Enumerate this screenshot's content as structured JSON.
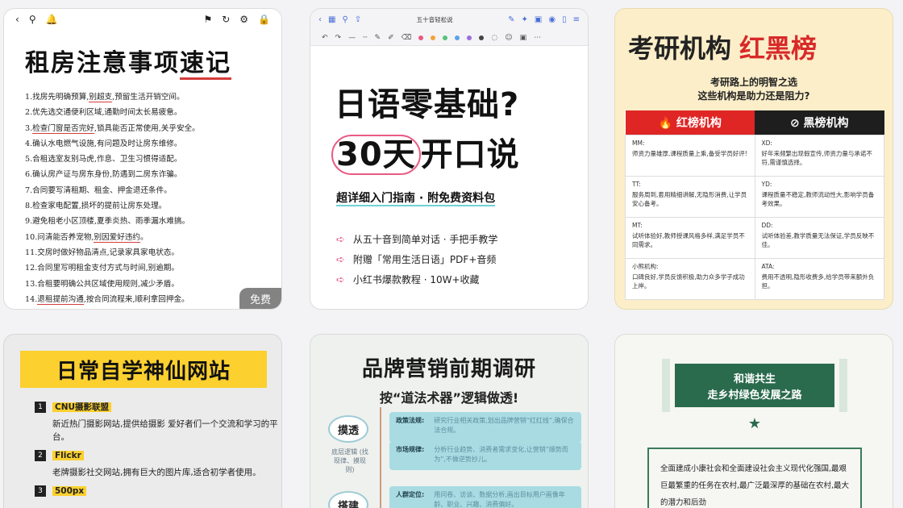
{
  "card1": {
    "title_main": "租房注意事项",
    "title_mark": "速记",
    "free_badge": "免费",
    "items": [
      {
        "pre": "1.找房先明确预算,",
        "mark": "别超支",
        "post": ",预留生活开销空间。"
      },
      {
        "pre": "2.优先选交通便利区域,通勤时间太长易疲惫。",
        "mark": "",
        "post": ""
      },
      {
        "pre": "3.",
        "mark": "检查门窗是否完好",
        "post": ",锁具能否正常使用,关乎安全。"
      },
      {
        "pre": "4.确认水电燃气设施,有问题及时让房东维修。",
        "mark": "",
        "post": ""
      },
      {
        "pre": "5.合租选室友别马虎,作息、卫生习惯得适配。",
        "mark": "",
        "post": ""
      },
      {
        "pre": "6.确认房产证与房东身份,防遇到二房东诈骗。",
        "mark": "",
        "post": ""
      },
      {
        "pre": "7.合同要写清租期、租金、押金退还条件。",
        "mark": "",
        "post": ""
      },
      {
        "pre": "8.检查家电配置,损坏的提前让房东处理。",
        "mark": "",
        "post": ""
      },
      {
        "pre": "9.避免租老小区顶楼,夏季炎热、雨季漏水难搞。",
        "mark": "",
        "post": ""
      },
      {
        "pre": "10.问清能否养宠物,",
        "mark": "别因爱好违约",
        "post": "。"
      },
      {
        "pre": "11.交房时做好物品清点,记录家具家电状态。",
        "mark": "",
        "post": ""
      },
      {
        "pre": "12.合同里写明租金支付方式与时间,别逾期。",
        "mark": "",
        "post": ""
      },
      {
        "pre": "13.合租要明确公共区域使用规则,减少矛盾。",
        "mark": "",
        "post": ""
      },
      {
        "pre": "14.",
        "mark": "退租提前沟通",
        "post": ",按合同流程来,顺利拿回押金。"
      }
    ]
  },
  "card2": {
    "doc_title": "五十音轻松说",
    "headline1": "日语零基础?",
    "headline2_circled": "30天",
    "headline2_rest": "开口说",
    "subtitle": "超详细入门指南 · 附免费资料包",
    "bullets": [
      "从五十音到简单对话 · 手把手教学",
      "附赠「常用生活日语」PDF+音频",
      "小红书爆款教程 · 10W+收藏"
    ],
    "colors": [
      "#e85a83",
      "#f3a33b",
      "#58c27a",
      "#5aa3e8",
      "#9a6ee0",
      "#444444"
    ]
  },
  "card3": {
    "title_black": "考研机构",
    "title_red": "红黑榜",
    "sub1": "考研路上的明智之选",
    "sub2": "这些机构是助力还是阻力?",
    "red_header": "🔥 红榜机构",
    "black_header": "⊘ 黑榜机构",
    "rows": [
      {
        "red": "MM:\n师资力量雄厚,课程质量上乘,备受学员好评!",
        "black": "XD:\n好年来频繁出现假宣传,师资力量与承诺不符,需谨慎选择。"
      },
      {
        "red": "TT:\n服务周到,套用精细讲解,无隐形消费,让学员安心备考。",
        "black": "YD:\n课程质量不稳定,教师流动性大,影响学员备考效果。"
      },
      {
        "red": "MT:\n试听体验好,教师授课风格多样,满足学员不同需求。",
        "black": "DD:\n试听体验差,教学质量无法保证,学员反映不佳。"
      },
      {
        "red": "小熊机构:\n口碑良好,学员反馈积极,助力众多学子成功上岸。",
        "black": "ATA:\n费用不透明,隐形收费多,给学员带来额外负担。"
      }
    ]
  },
  "card4": {
    "title": "日常自学神仙网站",
    "items": [
      {
        "num": "1",
        "tag": "CNU摄影联盟",
        "desc": "新近热门摄影网站,提供给摄影 爱好者们一个交流和学习的平台。"
      },
      {
        "num": "2",
        "tag": "Flickr",
        "desc": "老牌摄影社交网站,拥有巨大的图片库,适合初学者使用。"
      },
      {
        "num": "3",
        "tag": "500px",
        "desc": ""
      }
    ]
  },
  "card5": {
    "title": "品牌营销前期调研",
    "subtitle": "按“道法术器”逻辑做透!",
    "node1": "摸透",
    "node1_label": "底层逻辑\n(找现律、摸现则)",
    "node2": "搭建",
    "rows": [
      {
        "k": "政策法规:",
        "v": "研究行业相关政策,划出品牌营销“红红线”,确保合法合规。"
      },
      {
        "k": "市场规律:",
        "v": "分析行业趋势、消费者需求变化,让营销“顺势而为”,不做逆势抄儿。"
      },
      {
        "k": "人群定位:",
        "v": "用问卷、访谈、数据分析,画出目标用户画像年龄、职业、兴趣、消费偏好。"
      }
    ]
  },
  "card6": {
    "banner1": "和谐共生",
    "banner2": "走乡村绿色发展之路",
    "star": "★",
    "body": "全面建成小康社会和全面建设社会主义现代化强国,最艰巨最繁重的任务在农村,最广泛最深厚的基础在农村,最大的潜力和后劲"
  },
  "icons": {
    "back": "‹",
    "search": "⚲",
    "bell": "🔔",
    "flag": "⚑",
    "refresh": "↻",
    "settings": "⚙",
    "lock": "🔒"
  }
}
